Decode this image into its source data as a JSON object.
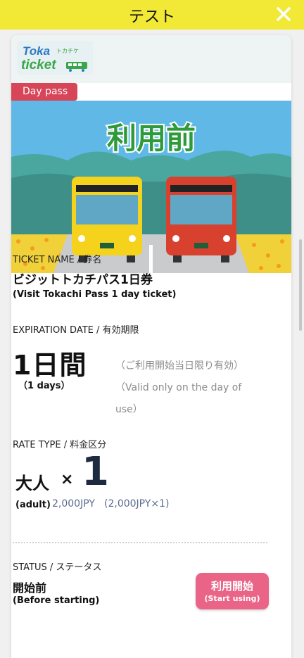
{
  "header": {
    "title": "テスト"
  },
  "logo": {
    "line1": "Toka",
    "line2": "ticket",
    "kana": "トカチケ"
  },
  "badge": {
    "label": "Day pass"
  },
  "hero": {
    "status_text": "利用前"
  },
  "ticket": {
    "label": "TICKET NAME / 券名",
    "name": "ビジットトカチパス1日券",
    "name_en": "(Visit Tokachi Pass 1 day ticket)"
  },
  "expiration": {
    "label": "EXPIRATION DATE / 有効期限",
    "value": "1日間",
    "value_en": "（1 days）",
    "note_ja": "（ご利用開始当日限り有効）",
    "note_en": "（Valid only on the day of use）"
  },
  "rate": {
    "label": "RATE TYPE / 料金区分",
    "type": "大人",
    "times": "×",
    "count": "1",
    "type_en": "(adult)",
    "price": "2,000JPY",
    "calc": "(2,000JPY×1)"
  },
  "status": {
    "label": "STATUS / ステータス",
    "value": "開始前",
    "value_en": "(Before starting)",
    "button_label": "利用開始",
    "button_sub": "(Start using)"
  },
  "colors": {
    "topbar": "#f2e836",
    "badge": "#d64558",
    "button": "#e96486",
    "hero_text": "#2e9a3a"
  }
}
